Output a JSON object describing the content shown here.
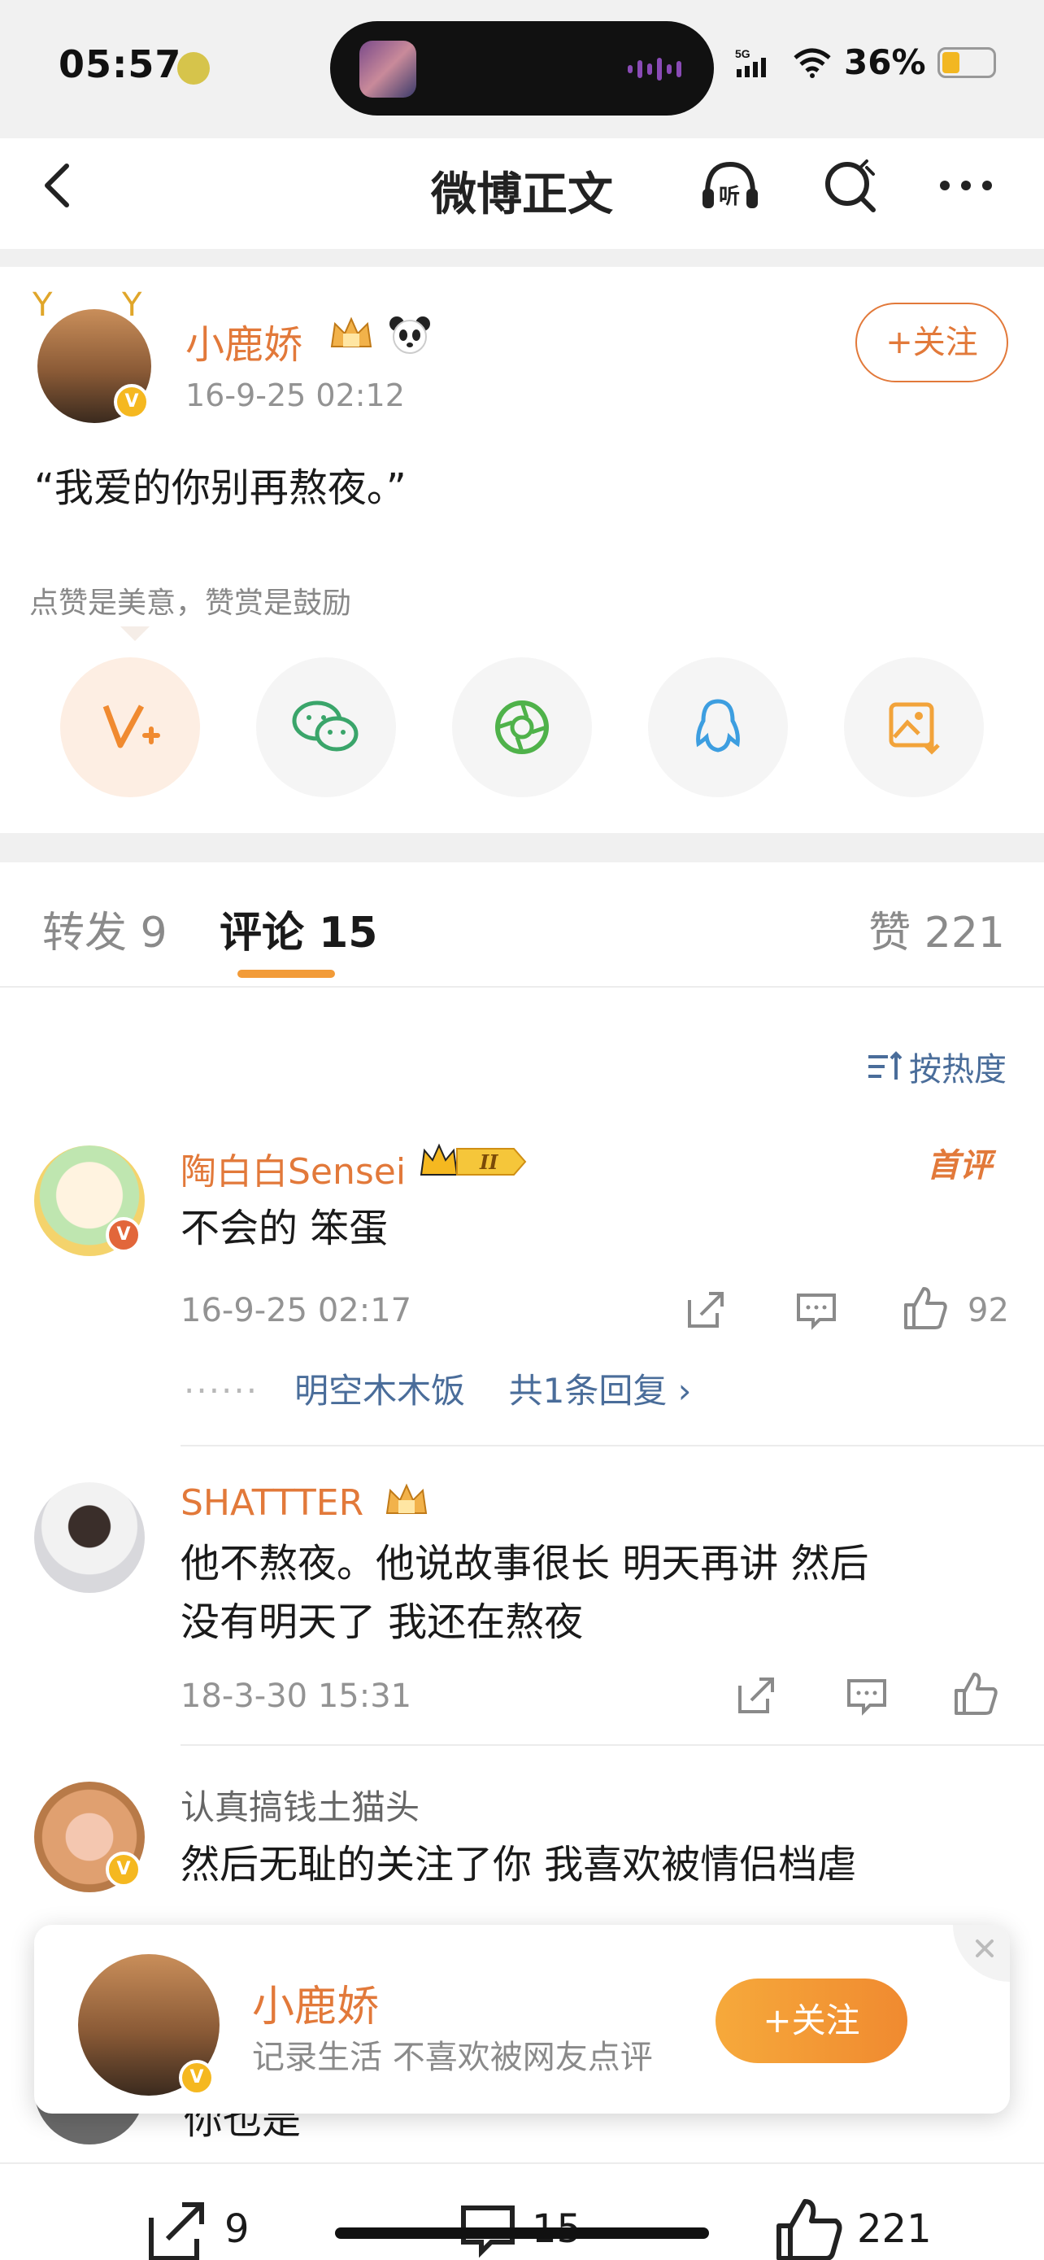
{
  "status_bar": {
    "time": "05:57",
    "network": "5G",
    "battery": "36%",
    "battery_level": 0.36
  },
  "nav": {
    "title": "微博正文"
  },
  "post": {
    "author": "小鹿娇",
    "time": "16-9-25 02:12",
    "follow_label": "+关注",
    "text": "“我爱的你别再熬夜。”",
    "reward_note": "点赞是美意，赞赏是鼓励"
  },
  "share_buttons": [
    "reward-icon",
    "wechat-icon",
    "moments-icon",
    "qq-icon",
    "save-image-icon"
  ],
  "tabs": {
    "repost": "转发 9",
    "comment": "评论 15",
    "like": "赞 221"
  },
  "sort_label": "按热度",
  "comments": [
    {
      "name": "陶白白Sensei",
      "text": "不会的 笨蛋",
      "time": "16-9-25 02:17",
      "likes": "92",
      "badge": "首评",
      "level": "II",
      "replies_from": "明空木木饭",
      "replies_label": "共1条回复 ›"
    },
    {
      "name": "SHATTTER",
      "text_line1": "他不熬夜。他说故事很长  明天再讲  然后",
      "text_line2": "没有明天了  我还在熬夜",
      "time": "18-3-30 15:31"
    },
    {
      "name": "认真搞钱土猫头",
      "text": "然后无耻的关注了你 我喜欢被情侣档虐"
    }
  ],
  "popup": {
    "name": "小鹿娇",
    "desc": "记录生活 不喜欢被网友点评",
    "follow_label": "+关注"
  },
  "peek_comment": {
    "text": "你也是"
  },
  "bottom_bar": {
    "repost_count": "9",
    "comment_count": "15",
    "like_count": "221"
  },
  "colors": {
    "accent": "#e2793a",
    "link": "#4a6d9a",
    "vip_gold": "#f5b820"
  }
}
